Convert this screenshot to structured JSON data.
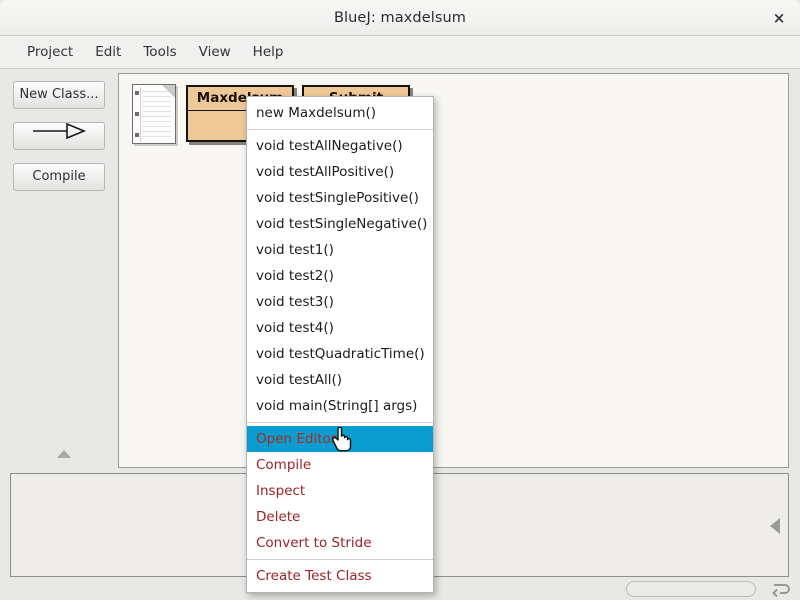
{
  "window": {
    "title": "BlueJ:  maxdelsum",
    "close_label": "×"
  },
  "menubar": {
    "items": [
      {
        "label": "Project"
      },
      {
        "label": "Edit"
      },
      {
        "label": "Tools"
      },
      {
        "label": "View"
      },
      {
        "label": "Help"
      }
    ]
  },
  "toolbar": {
    "new_class_label": "New Class...",
    "arrow_label": "",
    "compile_label": "Compile"
  },
  "diagram": {
    "readme_icon": "readme-document-icon",
    "classes": [
      {
        "name": "Maxdelsum",
        "color": "#efc898"
      },
      {
        "name": "Submit",
        "color": "#efc898"
      }
    ]
  },
  "context_menu": {
    "target_class": "Maxdelsum",
    "highlight_color": "#0b9dcf",
    "action_color": "#9b2226",
    "groups": [
      {
        "items": [
          {
            "label": "new Maxdelsum()",
            "kind": "constructor",
            "selected": false
          }
        ]
      },
      {
        "items": [
          {
            "label": "void testAllNegative()",
            "kind": "method",
            "selected": false
          },
          {
            "label": "void testAllPositive()",
            "kind": "method",
            "selected": false
          },
          {
            "label": "void testSinglePositive()",
            "kind": "method",
            "selected": false
          },
          {
            "label": "void testSingleNegative()",
            "kind": "method",
            "selected": false
          },
          {
            "label": "void test1()",
            "kind": "method",
            "selected": false
          },
          {
            "label": "void test2()",
            "kind": "method",
            "selected": false
          },
          {
            "label": "void test3()",
            "kind": "method",
            "selected": false
          },
          {
            "label": "void test4()",
            "kind": "method",
            "selected": false
          },
          {
            "label": "void testQuadraticTime()",
            "kind": "method",
            "selected": false
          },
          {
            "label": "void testAll()",
            "kind": "method",
            "selected": false
          },
          {
            "label": "void main(String[] args)",
            "kind": "method",
            "selected": false
          }
        ]
      },
      {
        "items": [
          {
            "label": "Open Editor",
            "kind": "action",
            "selected": true
          },
          {
            "label": "Compile",
            "kind": "action",
            "selected": false
          },
          {
            "label": "Inspect",
            "kind": "action",
            "selected": false
          },
          {
            "label": "Delete",
            "kind": "action",
            "selected": false
          },
          {
            "label": "Convert to Stride",
            "kind": "action",
            "selected": false
          }
        ]
      },
      {
        "items": [
          {
            "label": "Create Test Class",
            "kind": "action",
            "selected": false
          }
        ]
      }
    ]
  },
  "statusbar": {
    "progress_value": 0,
    "loop_icon": "loop-arrow-icon"
  },
  "bench": {
    "handle_icon": "collapse-left-triangle-icon"
  }
}
